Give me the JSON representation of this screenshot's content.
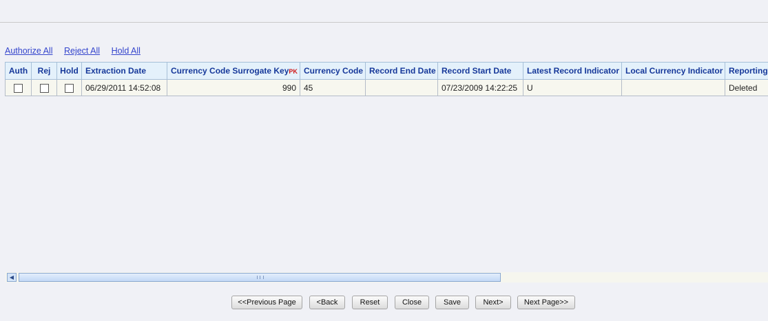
{
  "bulk_actions": {
    "authorize_all": "Authorize All",
    "reject_all": "Reject All",
    "hold_all": "Hold All"
  },
  "grid": {
    "headers": {
      "auth": "Auth",
      "rej": "Rej",
      "hold": "Hold",
      "extraction_date": "Extraction Date",
      "currency_code_surrogate_key": "Currency Code Surrogate Key",
      "pk_marker": "PK",
      "currency_code": "Currency Code",
      "record_end_date": "Record End Date",
      "record_start_date": "Record Start Date",
      "latest_record_indicator": "Latest Record Indicator",
      "local_currency_indicator": "Local Currency Indicator",
      "reporting": "Reporting"
    },
    "rows": [
      {
        "auth_checked": false,
        "rej_checked": false,
        "hold_checked": false,
        "extraction_date": "06/29/2011 14:52:08",
        "currency_code_surrogate_key": "990",
        "currency_code": "45",
        "record_end_date": "",
        "record_start_date": "07/23/2009 14:22:25",
        "latest_record_indicator": "U",
        "local_currency_indicator": "",
        "reporting": "Deleted"
      }
    ]
  },
  "scrollbar": {
    "left_arrow_icon": "arrow-left-icon",
    "position": 0.0
  },
  "footer": {
    "previous_page": "<<Previous Page",
    "back": "<Back",
    "reset": "Reset",
    "close": "Close",
    "save": "Save",
    "next": "Next>",
    "next_page": "Next Page>>"
  }
}
